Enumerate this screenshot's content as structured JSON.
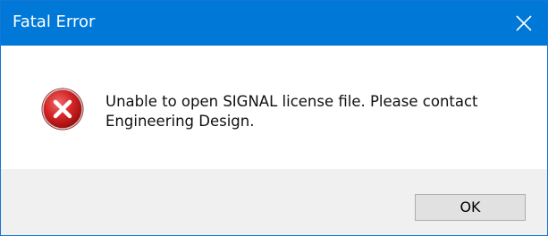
{
  "window": {
    "title": "Fatal Error",
    "close_icon": "close-icon",
    "titlebar_color": "#0078d7"
  },
  "content": {
    "icon": "error-icon",
    "message_line1": "Unable to open SIGNAL license file. Please contact",
    "message_line2": "Engineering Design."
  },
  "footer": {
    "ok_label": "OK"
  }
}
